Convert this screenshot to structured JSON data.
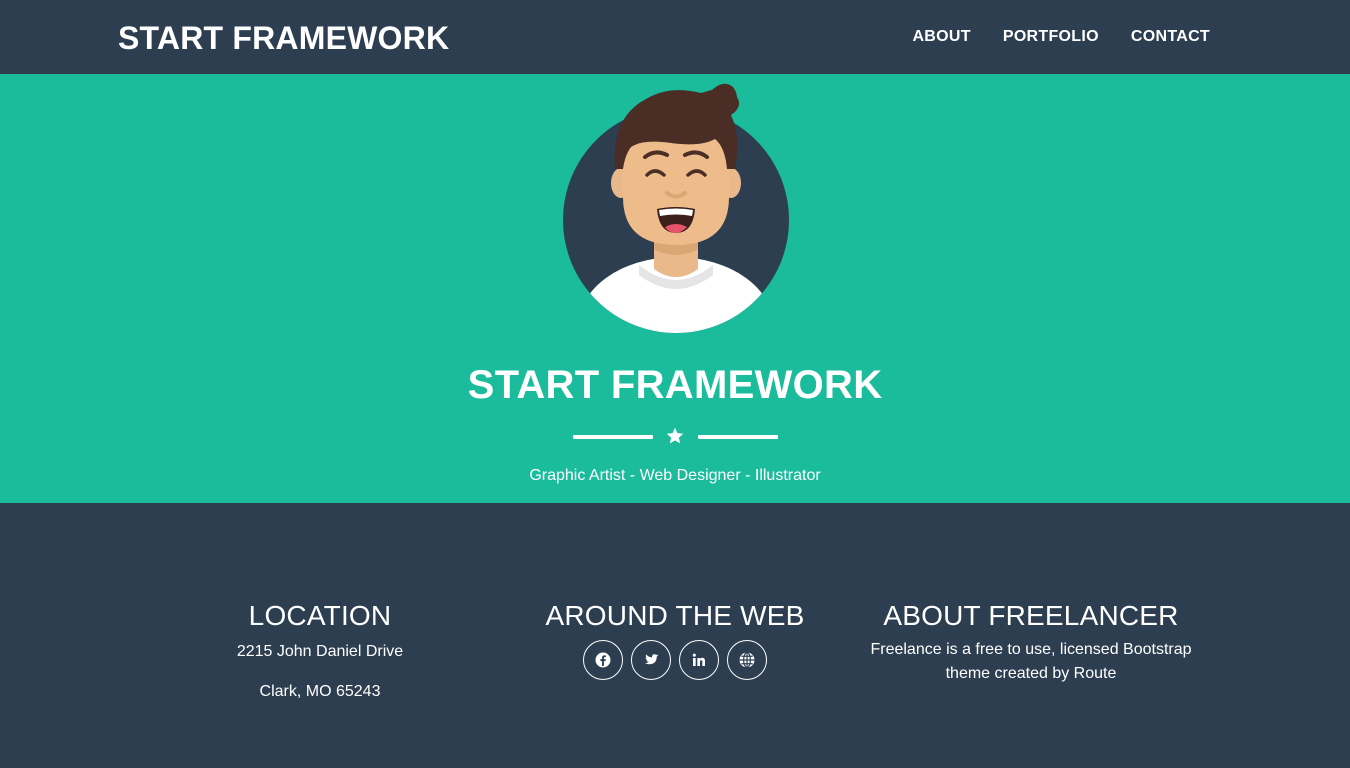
{
  "navbar": {
    "brand": "START FRAMEWORK",
    "links": [
      "ABOUT",
      "PORTFOLIO",
      "CONTACT"
    ]
  },
  "hero": {
    "title": "START FRAMEWORK",
    "divider_icon": "star-icon",
    "subtitle": "Graphic Artist - Web Designer - Illustrator"
  },
  "footer": {
    "location": {
      "heading": "LOCATION",
      "address_line1": "2215 John Daniel Drive",
      "address_line2": "Clark, MO 65243"
    },
    "web": {
      "heading": "AROUND THE WEB",
      "social_icons": [
        "facebook-icon",
        "twitter-icon",
        "linkedin-icon",
        "globe-icon"
      ]
    },
    "about": {
      "heading": "ABOUT FREELANCER",
      "text": "Freelance is a free to use, licensed Bootstrap theme created by Route"
    }
  },
  "colors": {
    "primary_dark": "#2c3e50",
    "accent_teal": "#1abc9c",
    "text": "#ffffff"
  }
}
